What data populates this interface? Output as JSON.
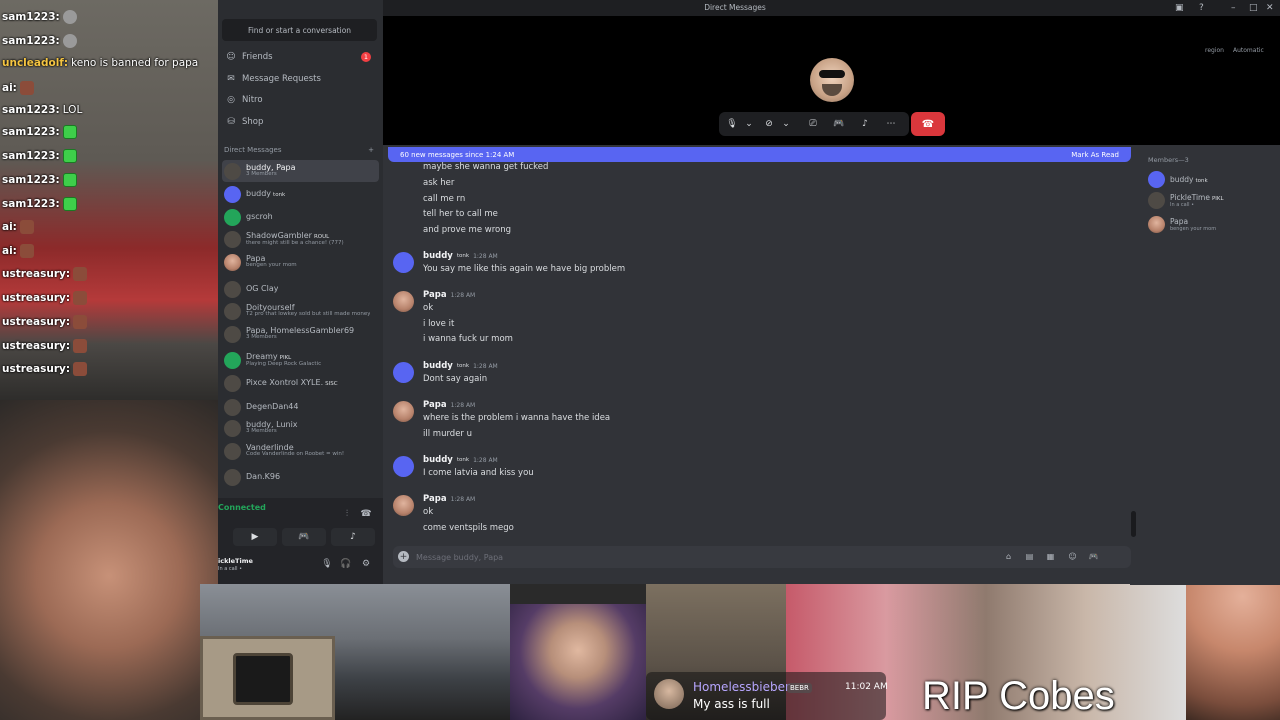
{
  "stream_chat": [
    {
      "user": "sam1223:",
      "text": "",
      "emote": "gray",
      "color": "#ffffff"
    },
    {
      "user": "sam1223:",
      "text": "",
      "emote": "gray",
      "color": "#ffffff"
    },
    {
      "user": "uncleadolf:",
      "text": "keno is banned for papa",
      "emote": "",
      "color": "#f5c542"
    },
    {
      "user": "ai:",
      "text": "",
      "emote": "face",
      "color": "#ffffff"
    },
    {
      "user": "sam1223:",
      "text": "LOL",
      "emote": "",
      "color": "#ffffff"
    },
    {
      "user": "sam1223:",
      "text": "",
      "emote": "green",
      "color": "#ffffff"
    },
    {
      "user": "sam1223:",
      "text": "",
      "emote": "green",
      "color": "#ffffff"
    },
    {
      "user": "sam1223:",
      "text": "",
      "emote": "green",
      "color": "#ffffff"
    },
    {
      "user": "sam1223:",
      "text": "",
      "emote": "green",
      "color": "#ffffff"
    },
    {
      "user": "ai:",
      "text": "",
      "emote": "face",
      "color": "#ffffff"
    },
    {
      "user": "ai:",
      "text": "",
      "emote": "face",
      "color": "#ffffff"
    },
    {
      "user": "ustreasury:",
      "text": "",
      "emote": "face",
      "color": "#ffffff"
    },
    {
      "user": "ustreasury:",
      "text": "",
      "emote": "face",
      "color": "#ffffff"
    },
    {
      "user": "ustreasury:",
      "text": "",
      "emote": "face",
      "color": "#ffffff"
    },
    {
      "user": "ustreasury:",
      "text": "",
      "emote": "face",
      "color": "#ffffff"
    },
    {
      "user": "ustreasury:",
      "text": "",
      "emote": "face",
      "color": "#ffffff"
    }
  ],
  "window": {
    "title": "Direct Messages"
  },
  "sidebar": {
    "search_label": "Find or start a conversation",
    "nav": [
      {
        "label": "Friends",
        "icon": "friends-icon"
      },
      {
        "label": "Message Requests",
        "icon": "mail-icon"
      },
      {
        "label": "Nitro",
        "icon": "nitro-icon"
      },
      {
        "label": "Shop",
        "icon": "shop-icon"
      }
    ],
    "friends_badge": "1",
    "dm_header": "Direct Messages",
    "dm_add": "+",
    "dms": [
      {
        "name": "buddy, Papa",
        "sub": "3 Members",
        "tag": "",
        "av": "av-dark",
        "active": true
      },
      {
        "name": "buddy",
        "sub": "",
        "tag": "tonk",
        "av": "av-buddy"
      },
      {
        "name": "gscroh",
        "sub": "",
        "tag": "",
        "av": "av-green"
      },
      {
        "name": "ShadowGambler",
        "sub": "there might still be a chance! (777)",
        "tag": "ROUL",
        "av": "av-dark"
      },
      {
        "name": "Papa",
        "sub": "bengen your mom",
        "tag": "",
        "av": "av-papa"
      },
      {
        "name": "OG Clay",
        "sub": "",
        "tag": "",
        "av": "av-dark"
      },
      {
        "name": "Doityourself",
        "sub": "T2 pro that lowkey sold but still made money",
        "tag": "",
        "av": "av-dark"
      },
      {
        "name": "Papa, HomelessGambler69",
        "sub": "3 Members",
        "tag": "",
        "av": "av-dark"
      },
      {
        "name": "Dreamy",
        "sub": "Playing Deep Rock Galactic",
        "tag": "PIKL",
        "av": "av-green"
      },
      {
        "name": "Pixce Xontrol XYLE.",
        "sub": "",
        "tag": "SISC",
        "av": "av-dark"
      },
      {
        "name": "DegenDan44",
        "sub": "",
        "tag": "",
        "av": "av-dark"
      },
      {
        "name": "buddy, Lunix",
        "sub": "3 Members",
        "tag": "",
        "av": "av-dark"
      },
      {
        "name": "Vanderlinde",
        "sub": "Code Vanderlinde on Roobet = win!",
        "tag": "",
        "av": "av-dark"
      },
      {
        "name": "Dan.K96",
        "sub": "",
        "tag": "",
        "av": "av-dark"
      }
    ],
    "voice_connected": "Connected",
    "user_name": "ickleTime",
    "user_status": "In a call •"
  },
  "call": {
    "region": "region",
    "auto": "Automatic"
  },
  "messages": {
    "new_bar": "60 new messages since 1:24 AM",
    "mark_read": "Mark As Read",
    "top_lines": [
      "maybe she wanna get fucked",
      "ask her",
      "call me rn",
      "tell her to call me",
      "and prove me wrong"
    ],
    "groups": [
      {
        "name": "buddy",
        "tag": "tonk",
        "time": "1:28 AM",
        "av": "av-buddy",
        "lines": [
          "You say me like this again we have big problem"
        ]
      },
      {
        "name": "Papa",
        "tag": "",
        "time": "1:28 AM",
        "av": "av-papa",
        "lines": [
          "ok",
          "i love it",
          "i wanna fuck ur mom"
        ]
      },
      {
        "name": "buddy",
        "tag": "tonk",
        "time": "1:28 AM",
        "av": "av-buddy",
        "lines": [
          "Dont say again"
        ]
      },
      {
        "name": "Papa",
        "tag": "",
        "time": "1:28 AM",
        "av": "av-papa",
        "lines": [
          "where is the problem i wanna have the idea",
          "ill murder u"
        ]
      },
      {
        "name": "buddy",
        "tag": "tonk",
        "time": "1:28 AM",
        "av": "av-buddy",
        "lines": [
          "I come latvia and kiss you"
        ]
      },
      {
        "name": "Papa",
        "tag": "",
        "time": "1:28 AM",
        "av": "av-papa",
        "lines": [
          "ok",
          "come ventspils mego"
        ]
      }
    ],
    "input_placeholder": "Message buddy, Papa"
  },
  "members": {
    "title": "Members—3",
    "list": [
      {
        "name": "buddy",
        "tag": "tonk",
        "sub": "",
        "av": "av-buddy"
      },
      {
        "name": "PickleTime",
        "tag": "PIKL",
        "sub": "In a call •",
        "av": "av-dark"
      },
      {
        "name": "Papa",
        "tag": "",
        "sub": "bengen your mom",
        "av": "av-papa"
      }
    ]
  },
  "overlay": {
    "chat_name": "Homelessbieber",
    "chat_tag": "BEBR",
    "chat_time": "11:02 AM",
    "chat_text": "My ass is full",
    "caption": "RIP Cobes"
  },
  "colors": {
    "blurple": "#5865f2",
    "red": "#da373c",
    "green": "#23a55a"
  }
}
